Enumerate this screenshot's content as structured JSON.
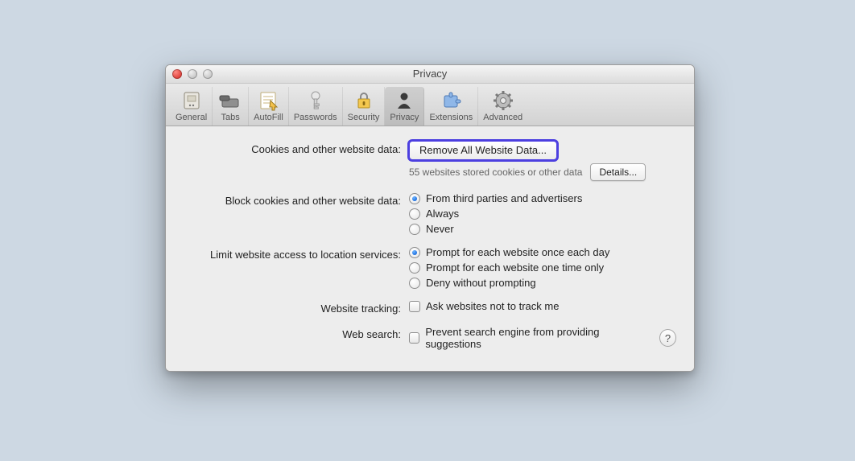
{
  "window": {
    "title": "Privacy"
  },
  "toolbar": {
    "items": [
      {
        "label": "General",
        "icon": "general"
      },
      {
        "label": "Tabs",
        "icon": "tabs"
      },
      {
        "label": "AutoFill",
        "icon": "autofill"
      },
      {
        "label": "Passwords",
        "icon": "passwords"
      },
      {
        "label": "Security",
        "icon": "security"
      },
      {
        "label": "Privacy",
        "icon": "privacy",
        "active": true
      },
      {
        "label": "Extensions",
        "icon": "extensions"
      },
      {
        "label": "Advanced",
        "icon": "advanced"
      }
    ]
  },
  "cookies": {
    "label": "Cookies and other website data:",
    "removeAllButton": "Remove All Website Data...",
    "summary": "55 websites stored cookies or other data",
    "detailsButton": "Details..."
  },
  "blockCookies": {
    "label": "Block cookies and other website data:",
    "options": [
      "From third parties and advertisers",
      "Always",
      "Never"
    ],
    "selectedIndex": 0
  },
  "location": {
    "label": "Limit website access to location services:",
    "options": [
      "Prompt for each website once each day",
      "Prompt for each website one time only",
      "Deny without prompting"
    ],
    "selectedIndex": 0
  },
  "tracking": {
    "label": "Website tracking:",
    "checkboxLabel": "Ask websites not to track me",
    "checked": false
  },
  "websearch": {
    "label": "Web search:",
    "checkboxLabel": "Prevent search engine from providing suggestions",
    "checked": false
  }
}
